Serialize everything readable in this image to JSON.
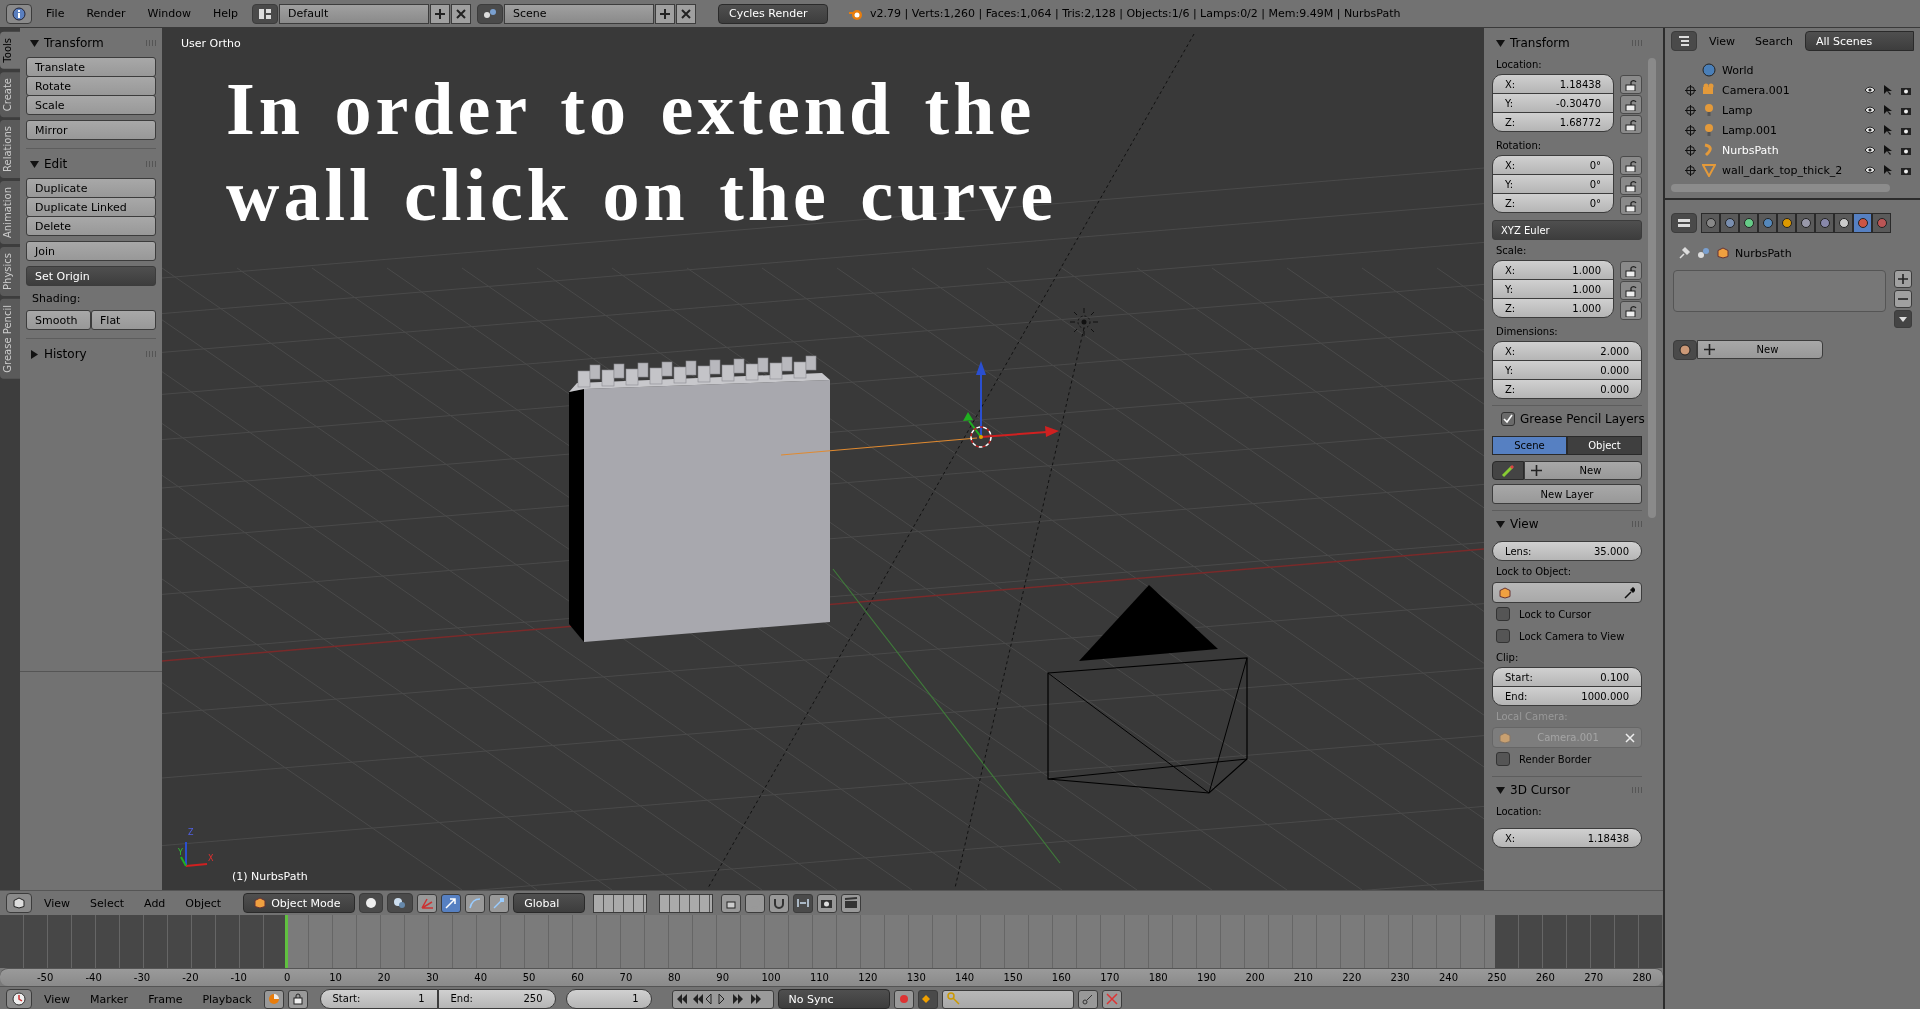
{
  "topbar": {
    "menus": [
      "File",
      "Render",
      "Window",
      "Help"
    ],
    "layout": "Default",
    "scene": "Scene",
    "engine": "Cycles Render",
    "stats": "v2.79 | Verts:1,260 | Faces:1,064 | Tris:2,128 | Objects:1/6 | Lamps:0/2 | Mem:9.49M | NurbsPath"
  },
  "side_tabs": [
    {
      "label": "Tools",
      "selected": true
    },
    {
      "label": "Create",
      "selected": false
    },
    {
      "label": "Relations",
      "selected": false
    },
    {
      "label": "Animation",
      "selected": false
    },
    {
      "label": "Physics",
      "selected": false
    },
    {
      "label": "Grease Pencil",
      "selected": false
    }
  ],
  "tool_shelf": {
    "panels": [
      {
        "title": "Transform",
        "expanded": true,
        "items": [
          {
            "kind": "buttons",
            "labels": [
              "Translate",
              "Rotate",
              "Scale"
            ]
          },
          {
            "kind": "buttons",
            "labels": [
              "Mirror"
            ]
          }
        ]
      },
      {
        "title": "Edit",
        "expanded": true,
        "items": [
          {
            "kind": "buttons",
            "labels": [
              "Duplicate",
              "Duplicate Linked",
              "Delete"
            ]
          },
          {
            "kind": "buttons",
            "labels": [
              "Join"
            ]
          },
          {
            "kind": "dropdown",
            "label": "Set Origin"
          },
          {
            "kind": "label",
            "label": "Shading:"
          },
          {
            "kind": "row",
            "labels": [
              "Smooth",
              "Flat"
            ]
          }
        ]
      },
      {
        "title": "History",
        "expanded": false
      }
    ]
  },
  "viewport": {
    "view_name": "User Ortho",
    "overlay_lines": [
      "In order to extend the",
      "wall click on the curve"
    ],
    "object_label": "(1) NurbsPath",
    "axes": [
      "Z",
      "Y",
      "X"
    ]
  },
  "n_panel": {
    "transform": {
      "title": "Transform",
      "groups": [
        {
          "label": "Location:",
          "locks": true,
          "fields": [
            {
              "label": "X:",
              "value": "1.18438"
            },
            {
              "label": "Y:",
              "value": "-0.30470"
            },
            {
              "label": "Z:",
              "value": "1.68772"
            }
          ]
        },
        {
          "label": "Rotation:",
          "locks": true,
          "fields": [
            {
              "label": "X:",
              "value": "0°"
            },
            {
              "label": "Y:",
              "value": "0°"
            },
            {
              "label": "Z:",
              "value": "0°"
            }
          ],
          "mode": "XYZ Euler"
        },
        {
          "label": "Scale:",
          "locks": true,
          "fields": [
            {
              "label": "X:",
              "value": "1.000"
            },
            {
              "label": "Y:",
              "value": "1.000"
            },
            {
              "label": "Z:",
              "value": "1.000"
            }
          ]
        },
        {
          "label": "Dimensions:",
          "locks": false,
          "fields": [
            {
              "label": "X:",
              "value": "2.000"
            },
            {
              "label": "Y:",
              "value": "0.000"
            },
            {
              "label": "Z:",
              "value": "0.000"
            }
          ]
        }
      ]
    },
    "grease_pencil": {
      "title": "Grease Pencil Layers",
      "enabled": true,
      "tabs": [
        {
          "label": "Scene",
          "selected": true
        },
        {
          "label": "Object",
          "selected": false
        }
      ],
      "new": "New",
      "new_layer": "New Layer"
    },
    "view": {
      "title": "View",
      "lens": {
        "label": "Lens:",
        "value": "35.000"
      },
      "lock_label": "Lock to Object:",
      "checks": [
        {
          "label": "Lock to Cursor",
          "checked": false
        },
        {
          "label": "Lock Camera to View",
          "checked": false
        }
      ],
      "clip_label": "Clip:",
      "clip": [
        {
          "label": "Start:",
          "value": "0.100"
        },
        {
          "label": "End:",
          "value": "1000.000"
        }
      ],
      "local_camera_label": "Local Camera:",
      "local_camera": "Camera.001",
      "local_camera_disabled": true,
      "render_border": {
        "label": "Render Border",
        "checked": false
      }
    },
    "cursor": {
      "title": "3D Cursor",
      "label": "Location:",
      "fields": [
        {
          "label": "X:",
          "value": "1.18438"
        }
      ]
    }
  },
  "outliner": {
    "menus": [
      "View",
      "Search"
    ],
    "scene_filter": "All Scenes",
    "items": [
      {
        "name": "World",
        "kind": "world",
        "selected": false
      },
      {
        "name": "Camera.001",
        "kind": "camera",
        "selected": false
      },
      {
        "name": "Lamp",
        "kind": "lamp",
        "selected": false
      },
      {
        "name": "Lamp.001",
        "kind": "lamp",
        "selected": false
      },
      {
        "name": "NurbsPath",
        "kind": "curve",
        "selected": true
      },
      {
        "name": "wall_dark_top_thick_2",
        "kind": "mesh",
        "selected": false
      }
    ]
  },
  "properties": {
    "tabs": [
      {
        "kind": "render",
        "selected": false
      },
      {
        "kind": "layers",
        "selected": false
      },
      {
        "kind": "scene",
        "selected": false
      },
      {
        "kind": "world",
        "selected": false
      },
      {
        "kind": "object",
        "selected": false
      },
      {
        "kind": "constraints",
        "selected": false
      },
      {
        "kind": "modifiers",
        "selected": false
      },
      {
        "kind": "data",
        "selected": false
      },
      {
        "kind": "material",
        "selected": true
      },
      {
        "kind": "texture",
        "selected": false
      }
    ],
    "breadcrumb": "NurbsPath",
    "new": "New"
  },
  "view3d_header": {
    "menus": [
      "View",
      "Select",
      "Add",
      "Object"
    ],
    "mode": "Object Mode",
    "orientation": "Global"
  },
  "timeline": {
    "ruler": [
      "-50",
      "-40",
      "-30",
      "-20",
      "-10",
      "0",
      "10",
      "20",
      "30",
      "40",
      "50",
      "60",
      "70",
      "80",
      "90",
      "100",
      "110",
      "120",
      "130",
      "140",
      "150",
      "160",
      "170",
      "180",
      "190",
      "200",
      "210",
      "220",
      "230",
      "240",
      "250",
      "260",
      "270",
      "280"
    ],
    "menus": [
      "View",
      "Marker",
      "Frame",
      "Playback"
    ],
    "start": {
      "label": "Start:",
      "value": "1"
    },
    "end": {
      "label": "End:",
      "value": "250"
    },
    "frame": "1",
    "sync": "No Sync"
  }
}
